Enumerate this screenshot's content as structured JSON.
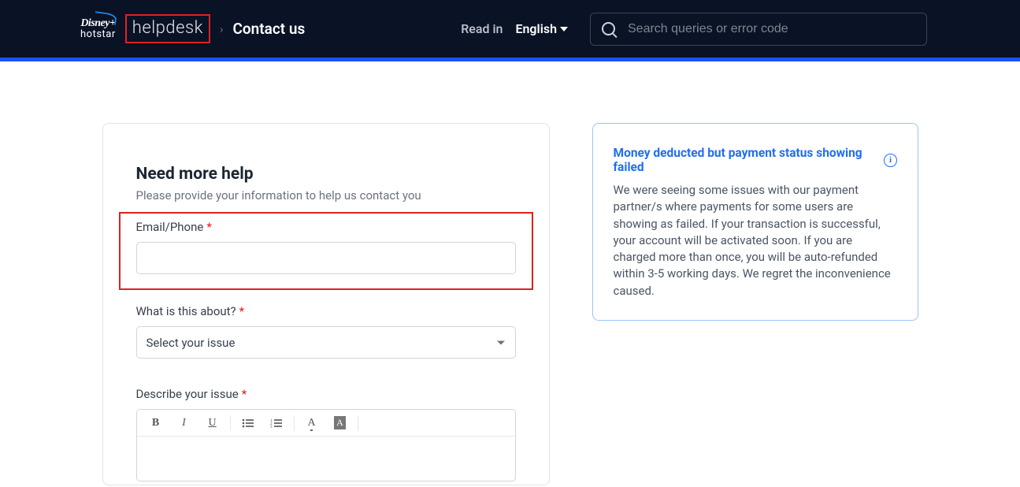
{
  "header": {
    "brand_top": "Disney+",
    "brand_bottom": "hotstar",
    "helpdesk": "helpdesk",
    "crumb": "Contact us",
    "read_in": "Read in",
    "language": "English",
    "search_placeholder": "Search queries or error code"
  },
  "form": {
    "title": "Need more help",
    "subtitle": "Please provide your information to help us contact you",
    "email_label": "Email/Phone",
    "about_label": "What is this about?",
    "about_placeholder": "Select your issue",
    "describe_label": "Describe your issue"
  },
  "alert": {
    "title": "Money deducted but payment status showing failed",
    "body": "We were seeing some issues with our payment partner/s where payments for some users are showing as failed. If your transaction is successful, your account will be activated soon. If you are charged more than once, you will be auto-refunded within 3-5 working days. We regret the inconvenience caused."
  }
}
